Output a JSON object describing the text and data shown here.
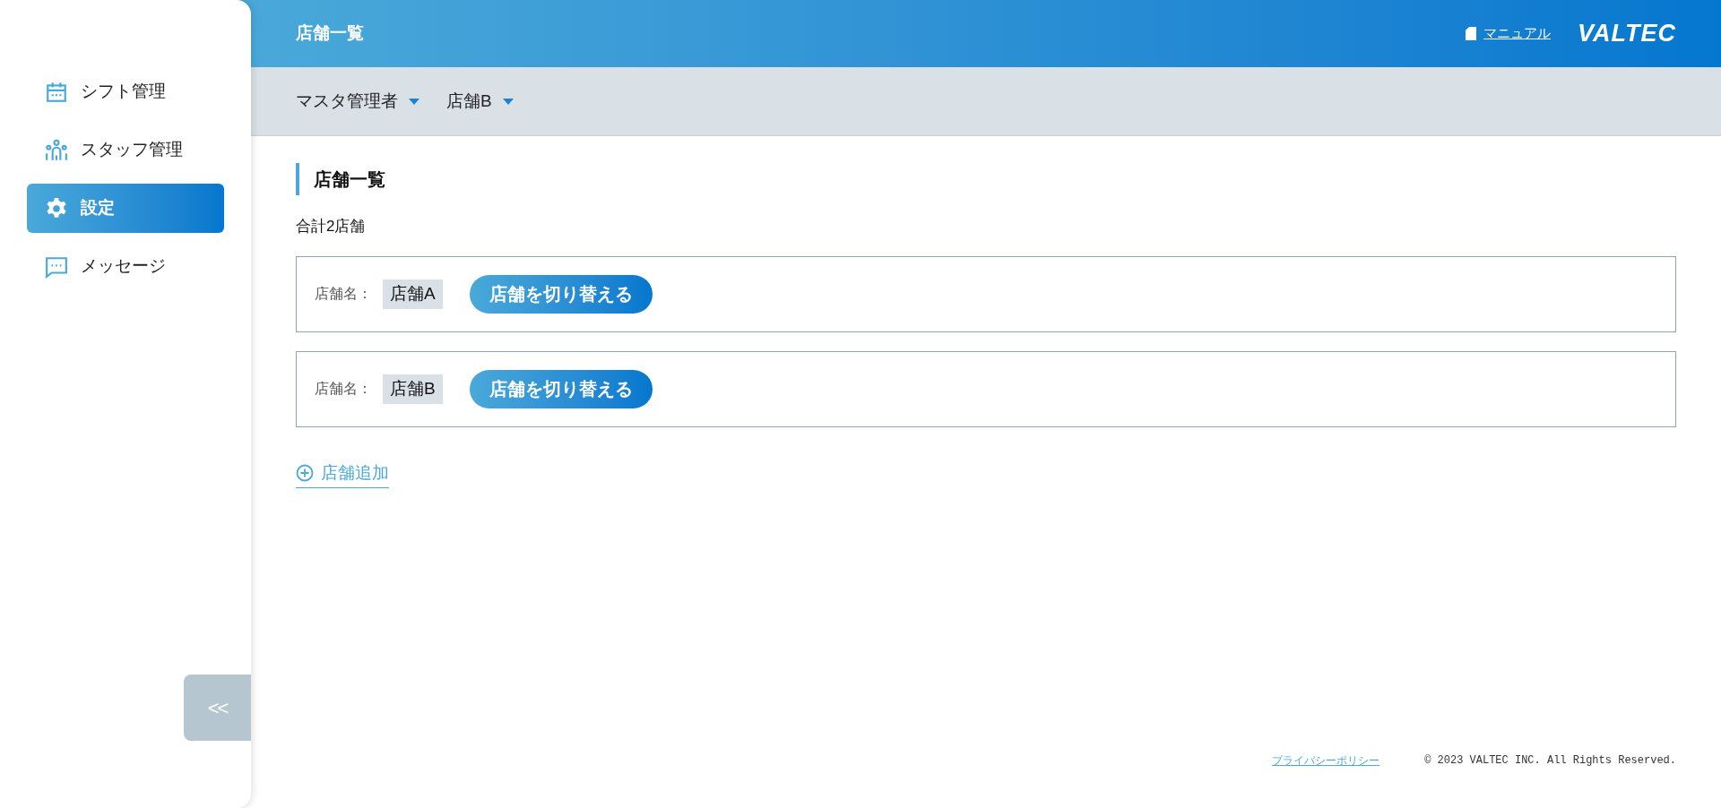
{
  "header": {
    "title": "店舗一覧",
    "manual_link": "マニュアル",
    "logo": "VALTEC"
  },
  "sidebar": {
    "items": [
      {
        "label": "シフト管理",
        "selected": false
      },
      {
        "label": "スタッフ管理",
        "selected": false
      },
      {
        "label": "設定",
        "selected": true
      },
      {
        "label": "メッセージ",
        "selected": false
      }
    ],
    "collapse_button": "<<"
  },
  "subheader": {
    "dropdowns": [
      "マスタ管理者",
      "店舗B"
    ]
  },
  "content": {
    "heading": "店舗一覧",
    "total": "合計2店舗",
    "stores": [
      {
        "label": "店舗名：",
        "name": "店舗A",
        "button": "店舗を切り替える"
      },
      {
        "label": "店舗名：",
        "name": "店舗B",
        "button": "店舗を切り替える"
      }
    ],
    "add_link": "店舗追加"
  },
  "footer": {
    "privacy_link": "プライバシーポリシー",
    "copyright": "© 2023 VALTEC INC. All Rights Reserved."
  }
}
